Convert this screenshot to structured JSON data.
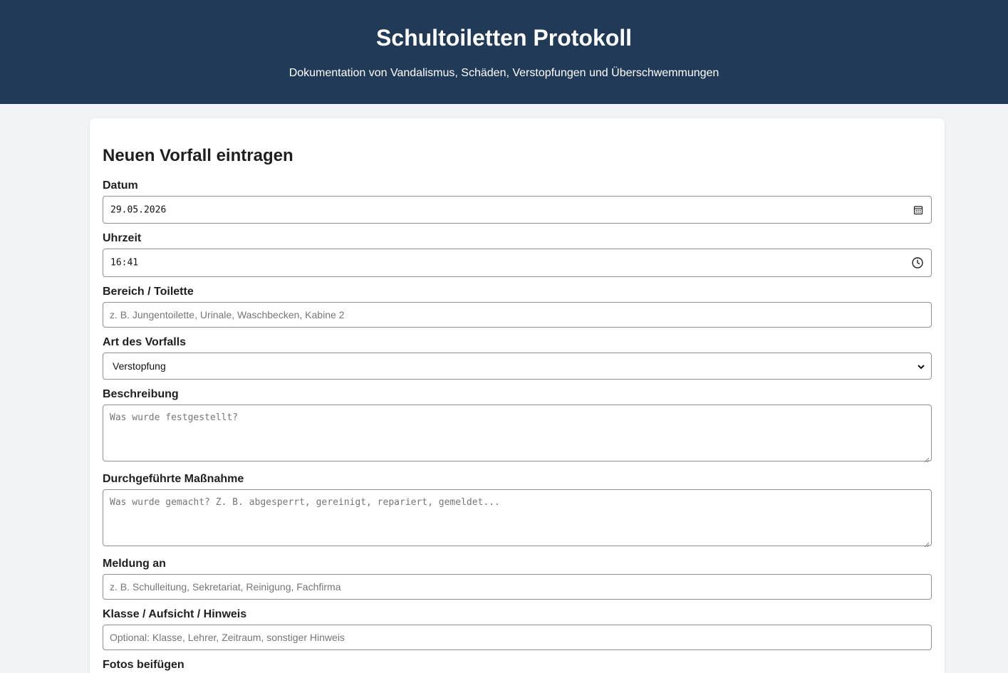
{
  "header": {
    "title": "Schultoiletten Protokoll",
    "subtitle": "Dokumentation von Vandalismus, Schäden, Verstopfungen und Überschwemmungen"
  },
  "form": {
    "title": "Neuen Vorfall eintragen",
    "date": {
      "label": "Datum",
      "value": "29.05.2026",
      "icon": "calendar-icon"
    },
    "time": {
      "label": "Uhrzeit",
      "value": "16:41",
      "icon": "clock-icon"
    },
    "area": {
      "label": "Bereich / Toilette",
      "placeholder": "z. B. Jungentoilette, Urinale, Waschbecken, Kabine 2"
    },
    "type": {
      "label": "Art des Vorfalls",
      "selected": "Verstopfung",
      "icon": "chevron-down-icon"
    },
    "description": {
      "label": "Beschreibung",
      "placeholder": "Was wurde festgestellt?"
    },
    "measure": {
      "label": "Durchgeführte Maßnahme",
      "placeholder": "Was wurde gemacht? Z. B. abgesperrt, gereinigt, repariert, gemeldet..."
    },
    "report_to": {
      "label": "Meldung an",
      "placeholder": "z. B. Schulleitung, Sekretariat, Reinigung, Fachfirma"
    },
    "note": {
      "label": "Klasse / Aufsicht / Hinweis",
      "placeholder": "Optional: Klasse, Lehrer, Zeitraum, sonstiger Hinweis"
    },
    "photos": {
      "label": "Fotos beifügen"
    }
  }
}
